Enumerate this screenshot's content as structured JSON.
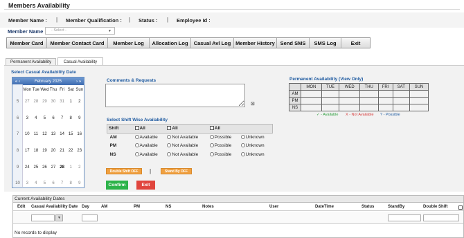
{
  "page": {
    "title": "Members Availability"
  },
  "member_info": {
    "name_label": "Member Name :",
    "qualification_label": "Member Qualification :",
    "status_label": "Status :",
    "employee_id_label": "Employee Id :",
    "separator": "|"
  },
  "member_select": {
    "label": "Member Name",
    "placeholder": "- Select -"
  },
  "toolbar": [
    "Member Card",
    "Member Contact Card",
    "Member Log",
    "Allocation Log",
    "Casual Avl Log",
    "Member History",
    "Send SMS",
    "SMS Log",
    "Exit"
  ],
  "tabs": [
    "Permanent Availability",
    "Casual Availability"
  ],
  "calendar": {
    "section_label": "Select Casual Availability Date",
    "month_label": "February 2025",
    "nav": {
      "prev_year": "«",
      "prev": "‹",
      "next": "›",
      "next_year": "»"
    },
    "weekdays": [
      "Mon",
      "Tue",
      "Wed",
      "Thu",
      "Fri",
      "Sat",
      "Sun"
    ],
    "weeks": [
      {
        "wk": "5",
        "days": [
          "27",
          "28",
          "29",
          "30",
          "31",
          "1",
          "2"
        ]
      },
      {
        "wk": "6",
        "days": [
          "3",
          "4",
          "5",
          "6",
          "7",
          "8",
          "9"
        ]
      },
      {
        "wk": "7",
        "days": [
          "10",
          "11",
          "12",
          "13",
          "14",
          "15",
          "16"
        ]
      },
      {
        "wk": "8",
        "days": [
          "17",
          "18",
          "19",
          "20",
          "21",
          "22",
          "23"
        ]
      },
      {
        "wk": "9",
        "days": [
          "24",
          "25",
          "26",
          "27",
          "28",
          "1",
          "2"
        ]
      },
      {
        "wk": "10",
        "days": [
          "3",
          "4",
          "5",
          "6",
          "7",
          "8",
          "9"
        ]
      }
    ]
  },
  "comments": {
    "label": "Comments & Requests",
    "value": ""
  },
  "shift_section": {
    "label": "Select Shift Wise Availability",
    "header": {
      "shift": "Shift",
      "all": "All"
    },
    "options": [
      "Available",
      "Not Available",
      "Possible",
      "Unknown"
    ],
    "rows": [
      "AM",
      "PM",
      "NS"
    ]
  },
  "actions": {
    "double_shift": "Double Shift OFF",
    "divider": "|",
    "stand_by": "Stand By OFF",
    "confirm": "Confirm",
    "exit": "Exit"
  },
  "permanent": {
    "label": "Permanent Availability (View Only)",
    "days": [
      "MON",
      "TUE",
      "WED",
      "THU",
      "FRI",
      "SAT",
      "SUN"
    ],
    "rows": [
      "AM",
      "PM",
      "NS"
    ],
    "legend": {
      "available": "✓ - Available",
      "not_available": "X - Not Available",
      "possible": "? - Possible"
    }
  },
  "grid": {
    "title": "Current Availability Dates",
    "columns": [
      "Edit",
      "Casual Availability Date",
      "Day",
      "AM",
      "PM",
      "NS",
      "Notes",
      "User",
      "DateTime",
      "Status",
      "StandBy",
      "Double Shift"
    ],
    "empty": "No records to display",
    "filter_icon": "▼"
  },
  "colors": {
    "accent_blue": "#1e5aa0",
    "confirm_green": "#2db34a",
    "exit_red": "#e0453d",
    "toggle_orange": "#f0a040"
  }
}
